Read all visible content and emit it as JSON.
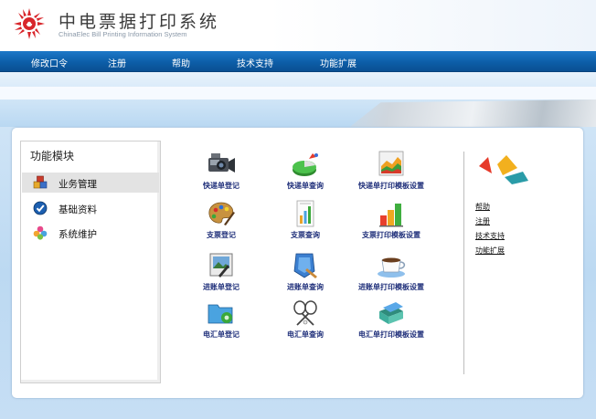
{
  "header": {
    "title": "中电票据打印系统",
    "subtitle": "ChinaElec Bill Printing Information System"
  },
  "nav": {
    "items": [
      "修改口令",
      "注册",
      "帮助",
      "技术支持",
      "功能扩展"
    ]
  },
  "modules": {
    "title": "功能模块",
    "items": [
      {
        "label": "业务管理",
        "icon": "boxes-icon",
        "active": true
      },
      {
        "label": "基础资料",
        "icon": "check-circle-icon",
        "active": false
      },
      {
        "label": "系统维护",
        "icon": "flower-icon",
        "active": false
      }
    ]
  },
  "functions": [
    {
      "label": "快递单登记",
      "icon": "camera-icon"
    },
    {
      "label": "快递单查询",
      "icon": "pie-chart-icon"
    },
    {
      "label": "快递单打印模板设置",
      "icon": "area-chart-icon"
    },
    {
      "label": "支票登记",
      "icon": "paint-palette-icon"
    },
    {
      "label": "支票查询",
      "icon": "report-icon"
    },
    {
      "label": "支票打印模板设置",
      "icon": "bar-chart-icon"
    },
    {
      "label": "进账单登记",
      "icon": "painting-icon"
    },
    {
      "label": "进账单查询",
      "icon": "shield-brush-icon"
    },
    {
      "label": "进账单打印模板设置",
      "icon": "teacup-icon"
    },
    {
      "label": "电汇单登记",
      "icon": "folder-gear-icon"
    },
    {
      "label": "电汇单查询",
      "icon": "rackets-icon"
    },
    {
      "label": "电汇单打印模板设置",
      "icon": "books-icon"
    }
  ],
  "side_links": [
    "帮助",
    "注册",
    "技术支持",
    "功能扩展"
  ],
  "colors": {
    "nav_blue": "#0d5ea8",
    "label_navy": "#1f2f7a",
    "logo_red": "#d8262b"
  }
}
